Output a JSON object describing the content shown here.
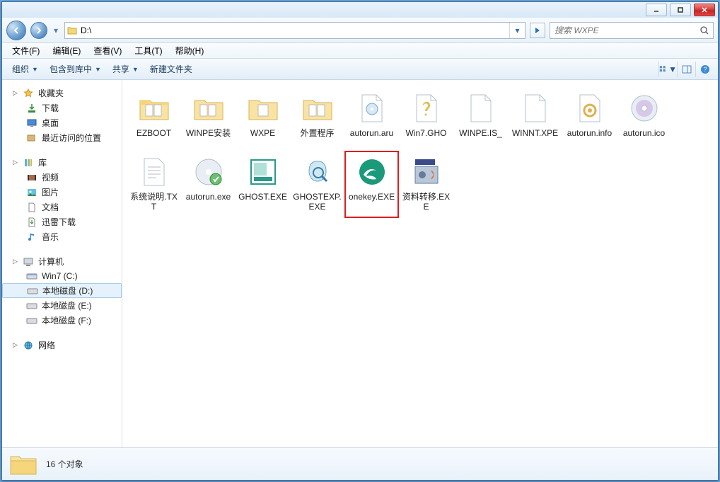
{
  "titlebar": {
    "min": "_",
    "max": "▢",
    "close": "×"
  },
  "nav": {
    "address": "D:\\",
    "search_placeholder": "搜索 WXPE"
  },
  "menu": {
    "file": "文件(F)",
    "edit": "编辑(E)",
    "view": "查看(V)",
    "tools": "工具(T)",
    "help": "帮助(H)"
  },
  "toolbar": {
    "organize": "组织",
    "include": "包含到库中",
    "share": "共享",
    "newfolder": "新建文件夹"
  },
  "sidebar": {
    "fav": {
      "label": "收藏夹",
      "downloads": "下载",
      "desktop": "桌面",
      "recent": "最近访问的位置"
    },
    "lib": {
      "label": "库",
      "video": "视频",
      "pictures": "图片",
      "documents": "文档",
      "xunlei": "迅雷下载",
      "music": "音乐"
    },
    "computer": {
      "label": "计算机",
      "c": "Win7 (C:)",
      "d": "本地磁盘 (D:)",
      "e": "本地磁盘 (E:)",
      "f": "本地磁盘 (F:)"
    },
    "network": {
      "label": "网络"
    }
  },
  "files": {
    "row1": {
      "a": "EZBOOT",
      "b": "WINPE安装",
      "c": "WXPE",
      "d": "外置程序",
      "e": "autorun.aru",
      "f": "Win7.GHO",
      "g": "WINPE.IS_",
      "h": "WINNT.XPE",
      "i": "autorun.info",
      "j": "autorun.ico",
      "k": "系统说明.TXT"
    },
    "row2": {
      "a": "autorun.exe",
      "b": "GHOST.EXE",
      "c": "GHOSTEXP.EXE",
      "d": "onekey.EXE",
      "e": "资料转移.EXE"
    }
  },
  "status": {
    "count": "16 个对象"
  }
}
